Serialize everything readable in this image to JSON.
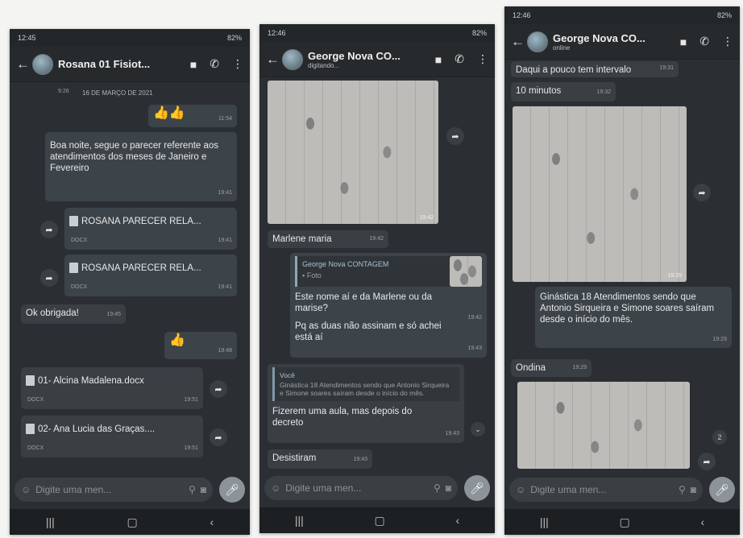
{
  "phones": [
    {
      "status": {
        "time": "12:45",
        "icons_left": "▪ ◎ ▪ •",
        "battery": "82%"
      },
      "contact": {
        "name": "Rosana 01 Fisiot...",
        "status": ""
      },
      "date_divider": "16 DE MARÇO DE 2021",
      "prev_time": "9:26",
      "messages": {
        "thumbs1": "👍👍",
        "thumbs1_time": "11:54",
        "text1": "Boa noite, segue o parecer referente aos atendimentos dos meses de Janeiro e Fevereiro",
        "text1_time": "19:41",
        "doc1_name": "ROSANA PARECER RELA...",
        "doc1_type": "DOCX",
        "doc1_time": "19:41",
        "doc2_name": "ROSANA PARECER RELA...",
        "doc2_type": "DOCX",
        "doc2_time": "19:41",
        "text2": "Ok obrigada!",
        "text2_time": "19:45",
        "thumbs2": "👍",
        "thumbs2_time": "19:48",
        "doc3_name": "01- Alcina Madalena.docx",
        "doc3_type": "DOCX",
        "doc3_time": "19:51",
        "doc4_name": "02- Ana Lucia das Graças....",
        "doc4_type": "DOCX",
        "doc4_time": "19:51"
      },
      "input_placeholder": "Digite uma men..."
    },
    {
      "status": {
        "time": "12:46",
        "icons_left": "▪ ▪ ⌁ •",
        "battery": "82%"
      },
      "contact": {
        "name": "George Nova CO...",
        "status": "digitando..."
      },
      "messages": {
        "photo1_time": "19:42",
        "text1": "Marlene maria",
        "text1_time": "19:42",
        "quote_author": "George Nova CONTAGEM",
        "quote_kind": "Foto",
        "text2": "Este nome aí e da Marlene ou da marise?",
        "text2_time": "19:42",
        "text3": "Pq as duas não assinam e só achei está aí",
        "text3_time": "19:43",
        "quote2_author": "Você",
        "quote2_text": "Ginástica 18 Atendimentos sendo que Antonio Sirqueira e Simone soares saíram desde o início do mês.",
        "text4": "Fizerem uma aula, mas depois do decreto",
        "text4_time": "19:43",
        "text5": "Desistiram",
        "text5_time": "19:43"
      },
      "input_placeholder": "Digite uma men..."
    },
    {
      "status": {
        "time": "12:46",
        "icons_left": "▪ ▪ ⌁ •",
        "battery": "82%"
      },
      "contact": {
        "name": "George Nova CO...",
        "status": "online"
      },
      "messages": {
        "text1": "Daqui a pouco tem intervalo",
        "text1_time": "19:31",
        "text2": "10 minutos",
        "text2_time": "19:32",
        "photo1_time": "19:29",
        "text3": "Ginástica 18 Atendimentos sendo que Antonio Sirqueira e Simone soares saíram desde o início do mês.",
        "text3_time": "19:29",
        "text4": "Ondina",
        "text4_time": "19:29",
        "unread": "2"
      },
      "input_placeholder": "Digite uma men..."
    }
  ],
  "navbar": {
    "recent": "|||",
    "home": "▢",
    "back": "‹"
  }
}
